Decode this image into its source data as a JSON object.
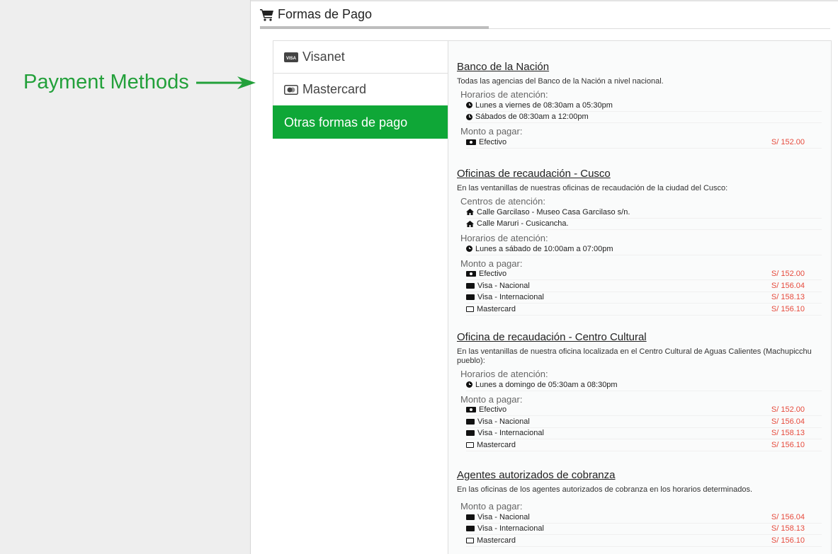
{
  "annotation": {
    "label": "Payment Methods"
  },
  "header": {
    "title": "Formas de Pago"
  },
  "tabs": [
    {
      "label": "Visanet",
      "icon": "visa-card-icon"
    },
    {
      "label": "Mastercard",
      "icon": "mastercard-icon"
    },
    {
      "label": "Otras formas de pago",
      "active": true
    }
  ],
  "colors": {
    "accent": "#0fa737",
    "price": "#e64a3c",
    "annotation": "#22a03a"
  },
  "sections": [
    {
      "title": "Banco de la Nación",
      "description": "Todas las agencias del Banco de la Nación a nivel nacional.",
      "hours_label": "Horarios de atención:",
      "hours": [
        "Lunes a viernes de 08:30am a 05:30pm",
        "Sábados de 08:30am a 12:00pm"
      ],
      "amount_label": "Monto a pagar:",
      "payments": [
        {
          "method": "Efectivo",
          "price": "S/ 152.00"
        }
      ]
    },
    {
      "title": "Oficinas de recaudación - Cusco",
      "description": "En las ventanillas de nuestras oficinas de recaudación de la ciudad del Cusco:",
      "centers_label": "Centros de atención:",
      "centers": [
        "Calle Garcilaso - Museo Casa Garcilaso s/n.",
        "Calle Maruri - Cusicancha."
      ],
      "hours_label": "Horarios de atención:",
      "hours": [
        "Lunes a sábado de 10:00am a 07:00pm"
      ],
      "amount_label": "Monto a pagar:",
      "payments": [
        {
          "method": "Efectivo",
          "price": "S/ 152.00"
        },
        {
          "method": "Visa - Nacional",
          "price": "S/ 156.04"
        },
        {
          "method": "Visa - Internacional",
          "price": "S/ 158.13"
        },
        {
          "method": "Mastercard",
          "price": "S/ 156.10"
        }
      ]
    },
    {
      "title": "Oficina de recaudación - Centro Cultural",
      "description": "En las ventanillas de nuestra oficina localizada en el Centro Cultural de Aguas Calientes (Machupicchu pueblo):",
      "hours_label": "Horarios de atención:",
      "hours": [
        "Lunes a domingo de 05:30am a 08:30pm"
      ],
      "amount_label": "Monto a pagar:",
      "payments": [
        {
          "method": "Efectivo",
          "price": "S/ 152.00"
        },
        {
          "method": "Visa - Nacional",
          "price": "S/ 156.04"
        },
        {
          "method": "Visa - Internacional",
          "price": "S/ 158.13"
        },
        {
          "method": "Mastercard",
          "price": "S/ 156.10"
        }
      ]
    },
    {
      "title": "Agentes autorizados de cobranza",
      "description": "En las oficinas de los agentes autorizados de cobranza en los horarios determinados.",
      "amount_label": "Monto a pagar:",
      "payments": [
        {
          "method": "Visa - Nacional",
          "price": "S/ 156.04"
        },
        {
          "method": "Visa - Internacional",
          "price": "S/ 158.13"
        },
        {
          "method": "Mastercard",
          "price": "S/ 156.10"
        }
      ]
    }
  ]
}
